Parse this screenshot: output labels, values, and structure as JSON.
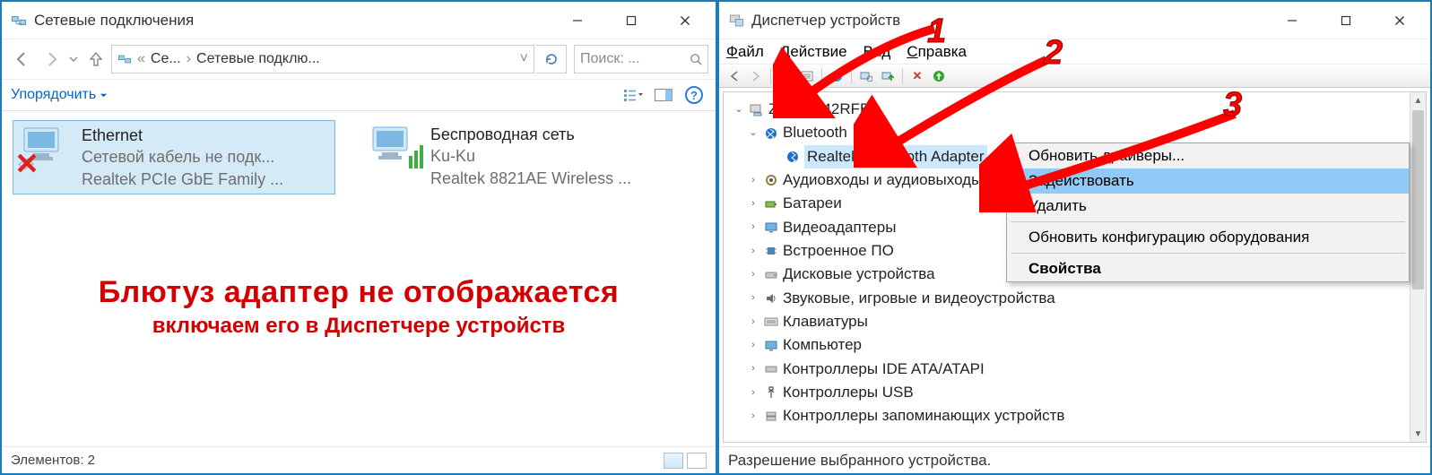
{
  "left": {
    "title": "Сетевые подключения",
    "crumb1": "Се...",
    "crumb2": "Сетевые подклю...",
    "search_placeholder": "Поиск: ...",
    "organize": "Упорядочить",
    "status_count": "Элементов: 2",
    "ethernet": {
      "name": "Ethernet",
      "sub1": "Сетевой кабель не подк...",
      "sub2": "Realtek PCIe GbE Family ..."
    },
    "wifi": {
      "name": "Беспроводная сеть",
      "sub1": "Ku-Ku",
      "sub2": "Realtek 8821AE Wireless ..."
    },
    "caption1": "Блютуз адаптер не отображается",
    "caption2": "включаем его в Диспетчере устройств"
  },
  "right": {
    "title": "Диспетчер устройств",
    "menu": {
      "file": "Файл",
      "action": "Действие",
      "view": "Вид",
      "help": "Справка"
    },
    "root": "ZV        VD-I42RFB5",
    "nodes": {
      "bluetooth": "Bluetooth",
      "bt_adapter": "Realtek Bluetooth Adapter",
      "audio": "Аудиовходы и аудиовыходы",
      "battery": "Батареи",
      "video": "Видеоадаптеры",
      "firmware": "Встроенное ПО",
      "disk": "Дисковые устройства",
      "sound": "Звуковые, игровые и видеоустройства",
      "keyboard": "Клавиатуры",
      "computer": "Компьютер",
      "ide": "Контроллеры IDE ATA/ATAPI",
      "usb": "Контроллеры USB",
      "storage": "Контроллеры запоминающих устройств"
    },
    "ctx": {
      "update": "Обновить драйверы...",
      "enable": "Задействовать",
      "delete": "Удалить",
      "refresh": "Обновить конфигурацию оборудования",
      "props": "Свойства"
    },
    "status": "Разрешение выбранного устройства.",
    "anno": {
      "n1": "1",
      "n2": "2",
      "n3": "3"
    }
  }
}
